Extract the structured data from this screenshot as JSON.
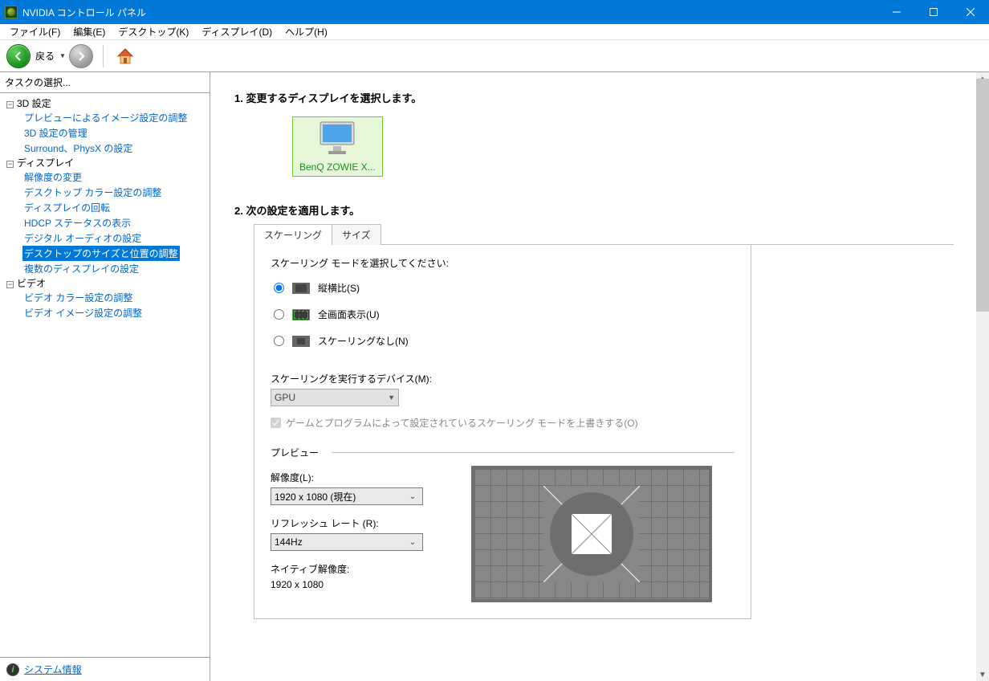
{
  "title": "NVIDIA コントロール パネル",
  "menu": {
    "file": "ファイル(F)",
    "edit": "編集(E)",
    "desktop": "デスクトップ(K)",
    "display": "ディスプレイ(D)",
    "help": "ヘルプ(H)"
  },
  "toolbar": {
    "back": "戻る"
  },
  "sidebar": {
    "header": "タスクの選択...",
    "cat_3d": "3D 設定",
    "cat_3d_items": {
      "preview": "プレビューによるイメージ設定の調整",
      "manage": "3D 設定の管理",
      "surround": "Surround、PhysX の設定"
    },
    "cat_display": "ディスプレイ",
    "cat_display_items": {
      "resolution": "解像度の変更",
      "desktop_color": "デスクトップ カラー設定の調整",
      "rotation": "ディスプレイの回転",
      "hdcp": "HDCP ステータスの表示",
      "digital_audio": "デジタル オーディオの設定",
      "size_position": "デスクトップのサイズと位置の調整",
      "multi_display": "複数のディスプレイの設定"
    },
    "cat_video": "ビデオ",
    "cat_video_items": {
      "video_color": "ビデオ カラー設定の調整",
      "video_image": "ビデオ イメージ設定の調整"
    },
    "system_info": "システム情報"
  },
  "main": {
    "step1_title": "1. 変更するディスプレイを選択します。",
    "monitor_name": "BenQ ZOWIE X...",
    "step2_title": "2. 次の設定を適用します。",
    "tab_scaling": "スケーリング",
    "tab_size": "サイズ",
    "scaling_mode_label": "スケーリング モードを選択してください:",
    "radio_aspect": "縦横比(S)",
    "radio_full": "全画面表示(U)",
    "radio_none": "スケーリングなし(N)",
    "device_label": "スケーリングを実行するデバイス(M):",
    "device_value": "GPU",
    "override_checkbox": "ゲームとプログラムによって設定されているスケーリング モードを上書きする(O)",
    "preview_label": "プレビュー",
    "resolution_label": "解像度(L):",
    "resolution_value": "1920 x 1080 (現在)",
    "refresh_label": "リフレッシュ レート (R):",
    "refresh_value": "144Hz",
    "native_label": "ネイティブ解像度:",
    "native_value": "1920 x 1080"
  }
}
